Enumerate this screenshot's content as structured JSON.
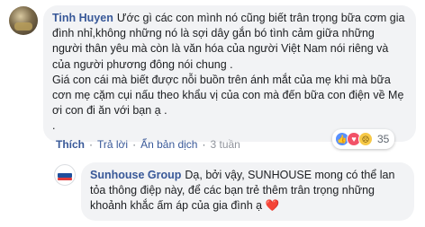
{
  "comment": {
    "author": "Tinh Huyen",
    "text": "Ước gì các con mình nó cũng biết trân trọng bữa cơm gia đình nhỉ,không những nó là sợi dây gắn bó tình cảm giữa những người thân yêu mà còn là văn hóa của người Việt Nam nói riêng và của người phương đông nói chung .\nGiá con cái mà biết được nỗi buồn trên ánh mắt của mẹ khi mà bữa cơn mẹ cặm cụi nấu theo khẩu vị của con mà đến bữa con điện về Mẹ ơi con đi ăn với bạn ạ .\n.",
    "reactions": {
      "icons": [
        "like-icon",
        "love-icon",
        "sad-icon"
      ],
      "count": "35"
    }
  },
  "actions": {
    "like": "Thích",
    "reply": "Trả lời",
    "translate": "Ẩn bản dịch",
    "separator": "·",
    "time": "3 tuần"
  },
  "reply": {
    "author": "Sunhouse Group",
    "text": "Dạ, bởi vậy, SUNHOUSE mong có thể lan tỏa thông điệp này, để các bạn trẻ thêm trân trọng những khoảnh khắc ấm áp của gia đình ạ ",
    "emoji": "❤️"
  },
  "colors": {
    "link": "#385898",
    "bubble": "#f2f3f5",
    "muted": "#606770"
  }
}
